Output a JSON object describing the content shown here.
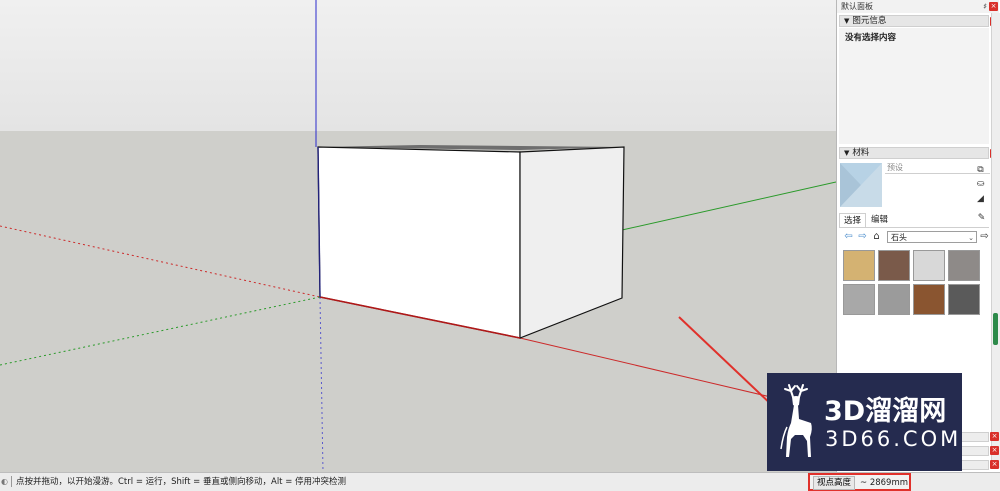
{
  "panel": {
    "title": "默认面板",
    "pin": "♯",
    "entity_info": {
      "heading": "图元信息",
      "empty_text": "没有选择内容"
    },
    "materials": {
      "heading": "材料",
      "current_name": "预设",
      "tabs": [
        "选择",
        "编辑"
      ],
      "library": "石头",
      "swatch_colors": [
        "#d4b272",
        "#7a5a4a",
        "#d8d8d8",
        "#8e8a88",
        "#a8a8a8",
        "#9b9b9b",
        "#8a5530",
        "#5a5a5a"
      ]
    }
  },
  "statusbar": {
    "hint": "点按并拖动，以开始漫游。Ctrl = 运行，Shift = 垂直或侧向移动，Alt = 停用冲突检测",
    "vcb_label": "视点高度",
    "vcb_value": "~ 2869mm"
  },
  "watermark": {
    "main": "3D溜溜网",
    "sub": "3D66.COM"
  },
  "colors": {
    "sky": "#ececec",
    "ground": "#cfcfcb",
    "red_axis": "#cc2a2a",
    "green_axis": "#2a9a2a",
    "blue_axis": "#2a2acc",
    "highlight": "#e0312b",
    "logo_bg": "#252b4f"
  }
}
